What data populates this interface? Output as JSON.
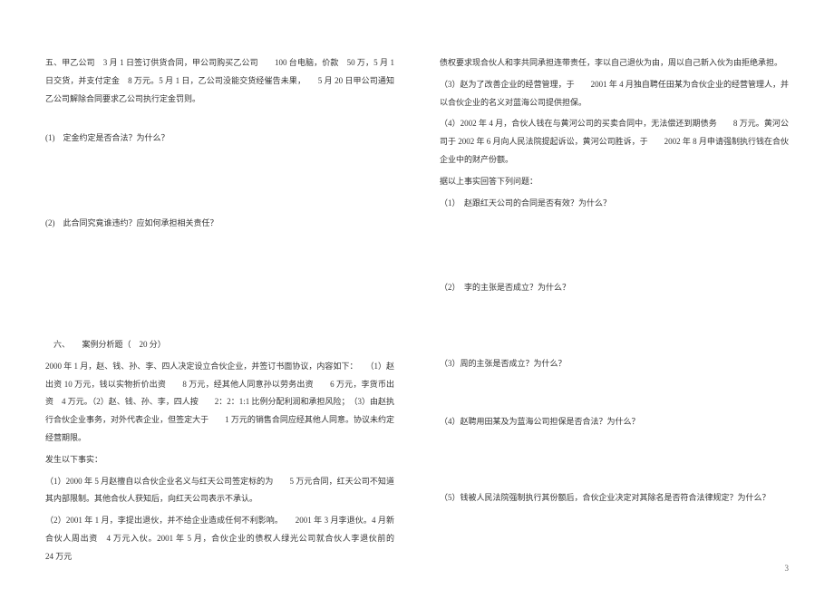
{
  "left_column": {
    "p1": "五、甲乙公司　3 月 1 日签订供货合同，甲公司购买乙公司　　100 台电脑，价款　50 万，5 月 1 日交货，并支付定金　8 万元。5 月 1 日，乙公司没能交货经催告未果，　　5 月 20 日甲公司通知乙公司解除合同要求乙公司执行定金罚则。",
    "q1": "(1)　定金约定是否合法？为什么？",
    "q2": "(2)　此合同究竟谁违约？应如何承担相关责任？",
    "section6_title": "　六、　　案例分析题（　20 分）",
    "p2": "2000 年 1 月，赵、钱、孙、李、四人决定设立合伙企业，并签订书面协议，内容如下：　　（1）赵出资 10 万元，钱以实物折价出资　　8 万元，经其他人同意孙以劳务出资　　6 万元，李货币出资　4 万元。（2）赵、钱、孙、李，四人按　　2：2：1:1 比例分配利润和承担风险；　（3）由赵执行合伙企业事务，对外代表企业，但签定大于　　1 万元的销售合同应经其他人同意。协议未约定经营期限。",
    "p3": "发生以下事实：",
    "p4": "（1）2000 年 5 月赵擅自以合伙企业名义与红天公司签定标的为　　5 万元合同，红天公司不知道其内部限制。其他合伙人获知后，向红天公司表示不承认。",
    "p5": "（2）2001 年 1 月，李提出退伙，并不给企业造成任何不利影响。　　2001 年 3 月李退伙。4 月新合伙人周出资　4 万元入伙。2001 年 5 月，合伙企业的债权人绿光公司就合伙人李退伙前的　　24 万元"
  },
  "right_column": {
    "p1": "债权要求现合伙人和李共同承担连带责任，李以自己退伙为由，周以自己新入伙为由拒绝承担。",
    "p2": "（3）赵为了改善企业的经营管理，于　　2001 年 4 月独自聘任田某为合伙企业的经营管理人，并以合伙企业的名义对蓝海公司提供担保。",
    "p3": "（4）2002 年 4 月，合伙人钱在与黄河公司的买卖合同中，无法偿还到期债务　　8 万元。黄河公司于 2002 年 6 月向人民法院提起诉讼，黄河公司胜诉，于　　2002 年 8 月申请强制执行钱在合伙企业中的财产份额。",
    "p4": "据以上事实回答下列问题：",
    "q1": "（1）　赵跟红天公司的合同是否有效？为什么？",
    "q2": "（2）　李的主张是否成立？为什么？",
    "q3": "（3）周的主张是否成立？为什么？",
    "q4": "（4）赵聘用田某及为蓝海公司担保是否合法？为什么？",
    "q5": "（5）钱被人民法院强制执行其份额后，合伙企业决定对其除名是否符合法律规定？为什么？"
  },
  "page_number": "3"
}
